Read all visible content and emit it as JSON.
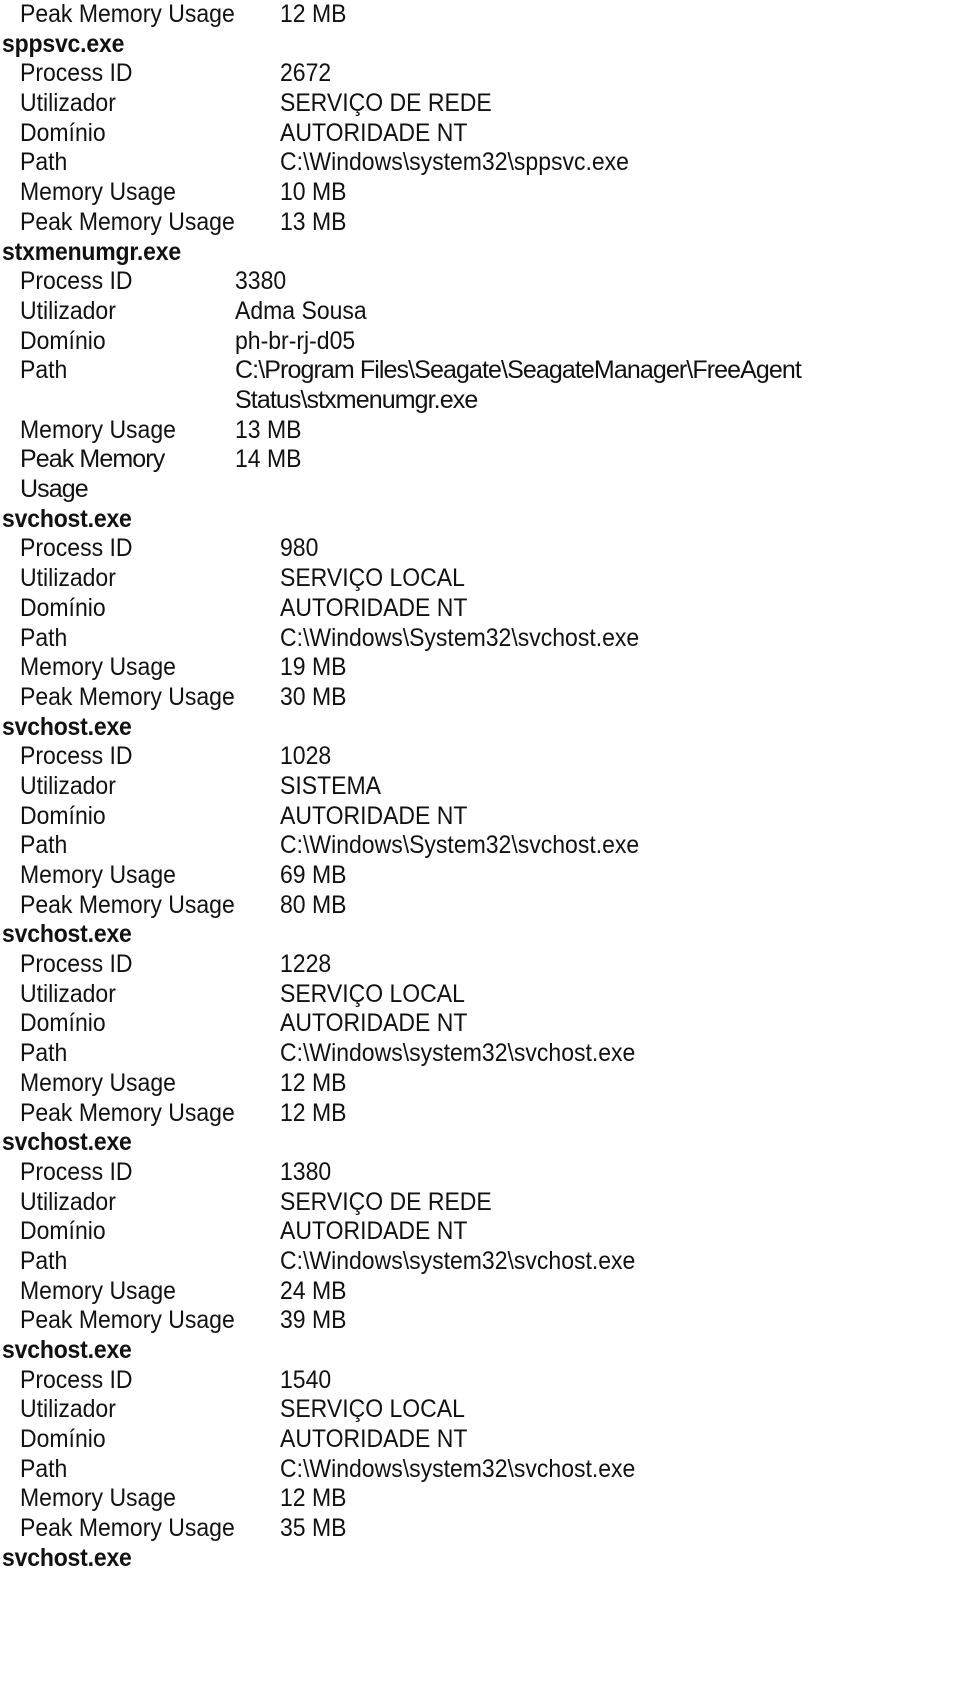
{
  "leading_row": {
    "label": "Peak Memory Usage",
    "value": "12 MB"
  },
  "processes": [
    {
      "name": "sppsvc.exe",
      "fields": [
        {
          "label": "Process ID",
          "value": "2672"
        },
        {
          "label": "Utilizador",
          "value": "SERVIÇO DE REDE"
        },
        {
          "label": "Domínio",
          "value": "AUTORIDADE NT"
        },
        {
          "label": "Path",
          "value": "C:\\Windows\\system32\\sppsvc.exe"
        },
        {
          "label": "Memory Usage",
          "value": "10 MB"
        },
        {
          "label": "Peak Memory Usage",
          "value": "13 MB"
        }
      ]
    },
    {
      "name": "stxmenumgr.exe",
      "fields": [
        {
          "label": "Process ID",
          "value": "3380"
        },
        {
          "label": "Utilizador",
          "value": "Adma Sousa"
        },
        {
          "label": "Domínio",
          "value": "ph-br-rj-d05"
        },
        {
          "label": "Path",
          "value": "C:\\Program Files\\Seagate\\SeagateManager\\FreeAgent Status\\stxmenumgr.exe"
        },
        {
          "label": "Memory Usage",
          "value": "13 MB"
        },
        {
          "label": "Peak Memory Usage",
          "value": "14 MB"
        }
      ]
    },
    {
      "name": "svchost.exe",
      "fields": [
        {
          "label": "Process ID",
          "value": "980"
        },
        {
          "label": "Utilizador",
          "value": "SERVIÇO LOCAL"
        },
        {
          "label": "Domínio",
          "value": "AUTORIDADE NT"
        },
        {
          "label": "Path",
          "value": "C:\\Windows\\System32\\svchost.exe"
        },
        {
          "label": "Memory Usage",
          "value": "19 MB"
        },
        {
          "label": "Peak Memory Usage",
          "value": "30 MB"
        }
      ]
    },
    {
      "name": "svchost.exe",
      "fields": [
        {
          "label": "Process ID",
          "value": "1028"
        },
        {
          "label": "Utilizador",
          "value": "SISTEMA"
        },
        {
          "label": "Domínio",
          "value": "AUTORIDADE NT"
        },
        {
          "label": "Path",
          "value": "C:\\Windows\\System32\\svchost.exe"
        },
        {
          "label": "Memory Usage",
          "value": "69 MB"
        },
        {
          "label": "Peak Memory Usage",
          "value": "80 MB"
        }
      ]
    },
    {
      "name": "svchost.exe",
      "fields": [
        {
          "label": "Process ID",
          "value": "1228"
        },
        {
          "label": "Utilizador",
          "value": "SERVIÇO LOCAL"
        },
        {
          "label": "Domínio",
          "value": "AUTORIDADE NT"
        },
        {
          "label": "Path",
          "value": "C:\\Windows\\system32\\svchost.exe"
        },
        {
          "label": "Memory Usage",
          "value": "12 MB"
        },
        {
          "label": "Peak Memory Usage",
          "value": "12 MB"
        }
      ]
    },
    {
      "name": "svchost.exe",
      "fields": [
        {
          "label": "Process ID",
          "value": "1380"
        },
        {
          "label": "Utilizador",
          "value": "SERVIÇO DE REDE"
        },
        {
          "label": "Domínio",
          "value": "AUTORIDADE NT"
        },
        {
          "label": "Path",
          "value": "C:\\Windows\\system32\\svchost.exe"
        },
        {
          "label": "Memory Usage",
          "value": "24 MB"
        },
        {
          "label": "Peak Memory Usage",
          "value": "39 MB"
        }
      ]
    },
    {
      "name": "svchost.exe",
      "fields": [
        {
          "label": "Process ID",
          "value": "1540"
        },
        {
          "label": "Utilizador",
          "value": "SERVIÇO LOCAL"
        },
        {
          "label": "Domínio",
          "value": "AUTORIDADE NT"
        },
        {
          "label": "Path",
          "value": "C:\\Windows\\system32\\svchost.exe"
        },
        {
          "label": "Memory Usage",
          "value": "12 MB"
        },
        {
          "label": "Peak Memory Usage",
          "value": "35 MB"
        }
      ]
    },
    {
      "name": "svchost.exe",
      "fields": []
    }
  ]
}
